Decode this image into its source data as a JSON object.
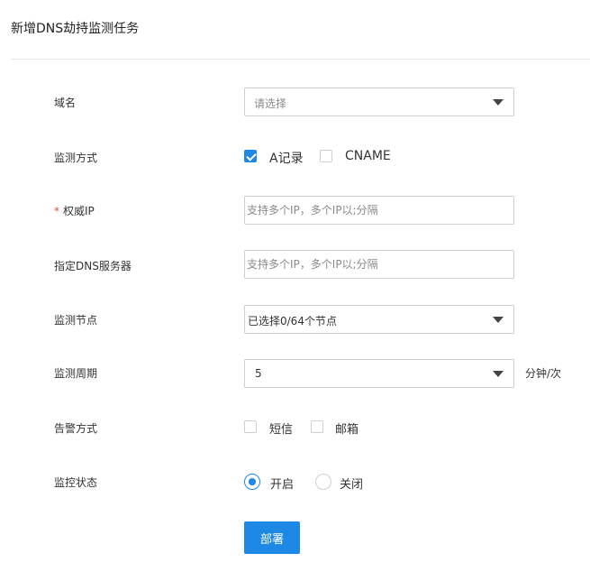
{
  "header": {
    "title": "新增DNS劫持监测任务"
  },
  "form": {
    "domain": {
      "label": "域名",
      "placeholder": "请选择"
    },
    "monitor_method": {
      "label": "监测方式",
      "options": [
        {
          "label": "A记录",
          "checked": true
        },
        {
          "label": "CNAME",
          "checked": false
        }
      ]
    },
    "authoritative_ip": {
      "required_mark": "*",
      "label": "权威IP",
      "placeholder": "支持多个IP，多个IP以;分隔"
    },
    "dns_server": {
      "label": "指定DNS服务器",
      "placeholder": "支持多个IP，多个IP以;分隔"
    },
    "monitor_nodes": {
      "label": "监测节点",
      "value": "已选择0/64个节点"
    },
    "monitor_period": {
      "label": "监测周期",
      "value": "5",
      "unit": "分钟/次"
    },
    "alert_method": {
      "label": "告警方式",
      "options": [
        {
          "label": "短信",
          "checked": false
        },
        {
          "label": "邮箱",
          "checked": false
        }
      ]
    },
    "monitor_status": {
      "label": "监控状态",
      "options": [
        {
          "label": "开启",
          "selected": true
        },
        {
          "label": "关闭",
          "selected": false
        }
      ]
    }
  },
  "actions": {
    "deploy_label": "部署"
  },
  "colors": {
    "accent": "#1e88e5",
    "required": "#e74c3c",
    "border": "#cfcfcf"
  }
}
